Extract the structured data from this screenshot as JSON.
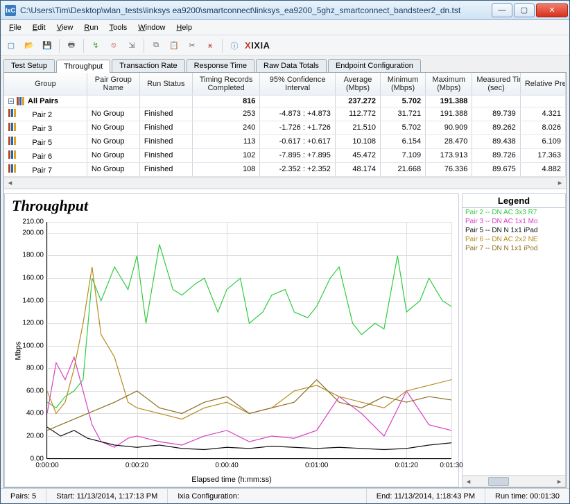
{
  "window": {
    "title": "C:\\Users\\Tim\\Desktop\\wlan_tests\\linksys ea9200\\smartconnect\\linksys_ea9200_5ghz_smartconnect_bandsteer2_dn.tst",
    "app_icon_text": "IxC"
  },
  "menu": {
    "file": "File",
    "edit": "Edit",
    "view": "View",
    "run": "Run",
    "tools": "Tools",
    "window": "Window",
    "help": "Help"
  },
  "toolbar_logo": {
    "x": "X",
    "rest": "IXIA"
  },
  "tabs": {
    "items": [
      "Test Setup",
      "Throughput",
      "Transaction Rate",
      "Response Time",
      "Raw Data Totals",
      "Endpoint Configuration"
    ],
    "active_index": 1
  },
  "grid": {
    "headers": [
      "Group",
      "Pair Group Name",
      "Run Status",
      "Timing Records Completed",
      "95% Confidence Interval",
      "Average (Mbps)",
      "Minimum (Mbps)",
      "Maximum (Mbps)",
      "Measured Time (sec)",
      "Relative Precision"
    ],
    "all_row": {
      "label": "All Pairs",
      "timing": "816",
      "avg": "237.272",
      "min": "5.702",
      "max": "191.388"
    },
    "rows": [
      {
        "name": "Pair 2",
        "group": "No Group",
        "status": "Finished",
        "timing": "253",
        "ci": "-4.873 : +4.873",
        "avg": "112.772",
        "min": "31.721",
        "max": "191.388",
        "time": "89.739",
        "prec": "4.321"
      },
      {
        "name": "Pair 3",
        "group": "No Group",
        "status": "Finished",
        "timing": "240",
        "ci": "-1.726 : +1.726",
        "avg": "21.510",
        "min": "5.702",
        "max": "90.909",
        "time": "89.262",
        "prec": "8.026"
      },
      {
        "name": "Pair 5",
        "group": "No Group",
        "status": "Finished",
        "timing": "113",
        "ci": "-0.617 : +0.617",
        "avg": "10.108",
        "min": "6.154",
        "max": "28.470",
        "time": "89.438",
        "prec": "6.109"
      },
      {
        "name": "Pair 6",
        "group": "No Group",
        "status": "Finished",
        "timing": "102",
        "ci": "-7.895 : +7.895",
        "avg": "45.472",
        "min": "7.109",
        "max": "173.913",
        "time": "89.726",
        "prec": "17.363"
      },
      {
        "name": "Pair 7",
        "group": "No Group",
        "status": "Finished",
        "timing": "108",
        "ci": "-2.352 : +2.352",
        "avg": "48.174",
        "min": "21.668",
        "max": "76.336",
        "time": "89.675",
        "prec": "4.882"
      }
    ]
  },
  "chart": {
    "title": "Throughput",
    "y_axis": "Mbps",
    "x_axis": "Elapsed time (h:mm:ss)"
  },
  "legend": {
    "title": "Legend",
    "items": [
      {
        "color": "#2ecc40",
        "label": "Pair 2 -- DN  AC 3x3 R7"
      },
      {
        "color": "#d63fc4",
        "label": "Pair 3 -- DN AC 1x1 Mo"
      },
      {
        "color": "#111111",
        "label": "Pair 5 -- DN N 1x1 iPad"
      },
      {
        "color": "#b58b1e",
        "label": "Pair 6 -- DN  AC 2x2 NE"
      },
      {
        "color": "#8a6d1e",
        "label": "Pair 7 -- DN  N 1x1 iPod"
      }
    ]
  },
  "status": {
    "pairs": "Pairs: 5",
    "start": "Start: 11/13/2014, 1:17:13 PM",
    "config": "Ixia Configuration:",
    "end": "End: 11/13/2014, 1:18:43 PM",
    "runtime": "Run time: 00:01:30"
  },
  "chart_data": {
    "type": "line",
    "xlabel": "Elapsed time (h:mm:ss)",
    "ylabel": "Mbps",
    "ylim": [
      0,
      210
    ],
    "xlim": [
      0,
      90
    ],
    "x_ticks": [
      0,
      20,
      40,
      60,
      80,
      90
    ],
    "x_tick_labels": [
      "0:00:00",
      "0:00:20",
      "0:00:40",
      "0:01:00",
      "0:01:20",
      "0:01:30"
    ],
    "y_ticks": [
      0,
      20,
      40,
      60,
      80,
      100,
      120,
      140,
      160,
      180,
      200,
      210
    ],
    "series": [
      {
        "name": "Pair 2",
        "color": "#2ecc40",
        "x": [
          0,
          2,
          4,
          6,
          8,
          10,
          12,
          15,
          18,
          20,
          22,
          25,
          28,
          30,
          33,
          35,
          38,
          40,
          43,
          45,
          48,
          50,
          53,
          55,
          58,
          60,
          63,
          65,
          68,
          70,
          73,
          75,
          78,
          80,
          83,
          85,
          88,
          90
        ],
        "values": [
          50,
          45,
          55,
          60,
          70,
          160,
          140,
          170,
          150,
          180,
          120,
          190,
          150,
          145,
          155,
          160,
          130,
          150,
          160,
          120,
          130,
          145,
          150,
          130,
          125,
          135,
          160,
          170,
          120,
          110,
          120,
          115,
          180,
          130,
          140,
          160,
          140,
          135
        ]
      },
      {
        "name": "Pair 3",
        "color": "#d63fc4",
        "x": [
          0,
          2,
          4,
          6,
          8,
          10,
          12,
          15,
          18,
          20,
          25,
          30,
          35,
          40,
          45,
          50,
          55,
          60,
          65,
          70,
          75,
          80,
          85,
          90
        ],
        "values": [
          40,
          85,
          70,
          90,
          60,
          30,
          15,
          10,
          18,
          20,
          15,
          12,
          20,
          25,
          15,
          20,
          18,
          25,
          55,
          40,
          20,
          60,
          30,
          25
        ]
      },
      {
        "name": "Pair 5",
        "color": "#111111",
        "x": [
          0,
          3,
          6,
          9,
          12,
          15,
          20,
          25,
          30,
          35,
          40,
          45,
          50,
          55,
          60,
          65,
          70,
          75,
          80,
          85,
          90
        ],
        "values": [
          28,
          20,
          25,
          18,
          15,
          12,
          10,
          12,
          9,
          8,
          10,
          9,
          11,
          10,
          9,
          10,
          9,
          8,
          9,
          12,
          14
        ]
      },
      {
        "name": "Pair 6",
        "color": "#b58b1e",
        "x": [
          0,
          2,
          4,
          6,
          8,
          10,
          12,
          15,
          18,
          20,
          25,
          30,
          35,
          40,
          45,
          50,
          55,
          60,
          65,
          70,
          75,
          80,
          85,
          90
        ],
        "values": [
          60,
          40,
          50,
          80,
          120,
          170,
          110,
          90,
          50,
          45,
          40,
          35,
          45,
          50,
          40,
          45,
          60,
          65,
          55,
          50,
          45,
          60,
          65,
          70
        ]
      },
      {
        "name": "Pair 7",
        "color": "#8a6d1e",
        "x": [
          0,
          3,
          6,
          9,
          12,
          15,
          20,
          25,
          30,
          35,
          40,
          45,
          50,
          55,
          60,
          65,
          70,
          75,
          80,
          85,
          90
        ],
        "values": [
          25,
          30,
          35,
          40,
          45,
          50,
          60,
          45,
          40,
          50,
          55,
          40,
          45,
          50,
          70,
          50,
          45,
          55,
          50,
          55,
          52
        ]
      }
    ]
  }
}
